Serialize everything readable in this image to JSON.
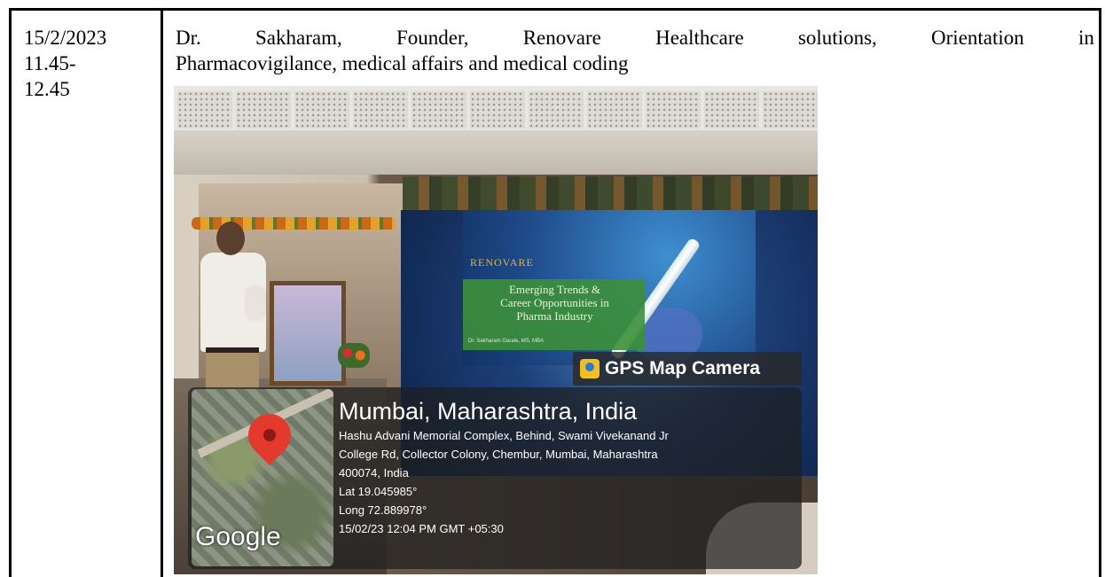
{
  "row": {
    "date": "15/2/2023",
    "time_start": "11.45-",
    "time_end": "12.45",
    "description_line1_words": [
      "Dr.",
      "Sakharam,",
      "Founder,",
      "Renovare",
      "Healthcare",
      "solutions,",
      "Orientation",
      "in"
    ],
    "description_line2": "Pharmacovigilance, medical affairs and medical coding"
  },
  "photo": {
    "slide": {
      "logo": "RENOVARE",
      "title": "Emerging Trends &\nCareer Opportunities in\nPharma Industry",
      "subtitle": "Dr. Sakharam Garale, MS, MBA"
    },
    "gps": {
      "badge": "GPS Map Camera",
      "city": "Mumbai, Maharashtra, India",
      "address_line1": "Hashu Advani Memorial Complex, Behind, Swami Vivekanand Jr",
      "address_line2": "College Rd, Collector Colony, Chembur, Mumbai, Maharashtra",
      "address_line3": "400074, India",
      "lat": "Lat 19.045985°",
      "long": "Long 72.889978°",
      "timestamp": "15/02/23 12:04 PM GMT +05:30",
      "map_brand": "Google"
    }
  }
}
